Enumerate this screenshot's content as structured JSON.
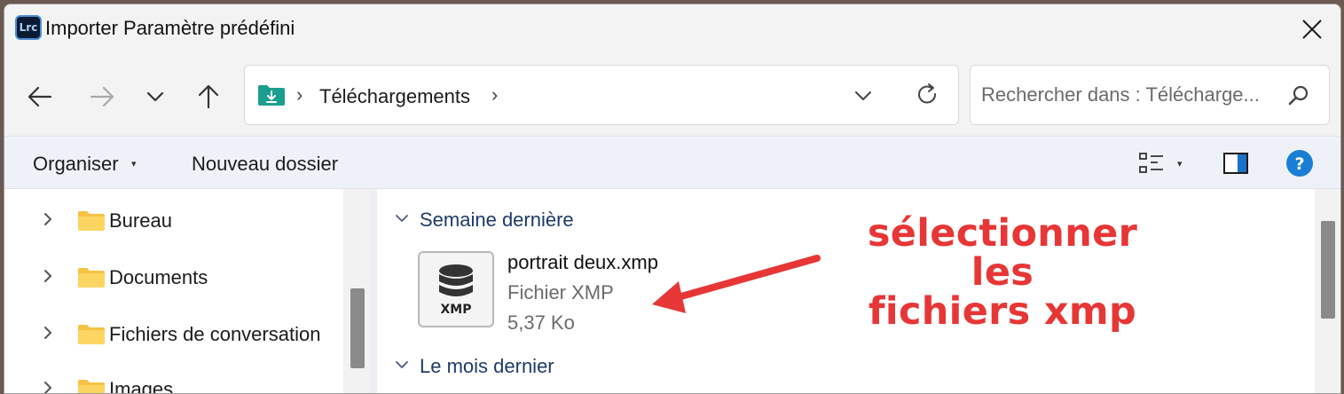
{
  "window": {
    "app_logo": "Lrc",
    "title": "Importer Paramètre prédéfini",
    "close_icon": "close-icon"
  },
  "nav": {
    "back_icon": "arrow-left-icon",
    "forward_icon": "arrow-right-icon",
    "recent_icon": "chevron-down-icon",
    "up_icon": "arrow-up-icon"
  },
  "address": {
    "folder_icon": "downloads-folder-icon",
    "separator": "›",
    "crumb": "Téléchargements",
    "dropdown_icon": "chevron-down-icon",
    "refresh_icon": "refresh-icon"
  },
  "search": {
    "placeholder": "Rechercher dans : Télécharge...",
    "icon": "search-icon"
  },
  "commands": {
    "organiser": "Organiser",
    "caret": "▾",
    "new_folder": "Nouveau dossier",
    "view_icon": "view-options-icon",
    "pane_icon": "details-pane-icon",
    "help_icon": "help-icon",
    "help_label": "?"
  },
  "tree": {
    "items": [
      {
        "label": "Bureau"
      },
      {
        "label": "Documents"
      },
      {
        "label": "Fichiers de conversation"
      },
      {
        "label": "Images"
      }
    ]
  },
  "content": {
    "groups": [
      {
        "label": "Semaine dernière"
      },
      {
        "label": "Le mois dernier"
      }
    ],
    "file": {
      "icon_label": "XMP",
      "name": "portrait deux.xmp",
      "type": "Fichier XMP",
      "size": "5,37 Ko"
    }
  },
  "annotation": {
    "line1": "sélectionner les",
    "line2": "fichiers xmp",
    "color": "#e73636"
  },
  "colors": {
    "accent": "#0067c0",
    "folder": "#f5c242",
    "group_header": "#1e3a68"
  }
}
